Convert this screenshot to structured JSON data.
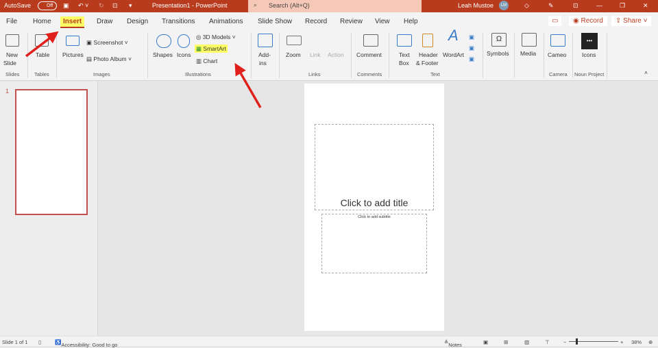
{
  "titlebar": {
    "autosave": "AutoSave",
    "toggle": "Off",
    "title": "Presentation1 - PowerPoint",
    "search_placeholder": "Search (Alt+Q)",
    "user": "Leah Mustoe",
    "user_initials": "LM"
  },
  "tabs": [
    "File",
    "Home",
    "Insert",
    "Draw",
    "Design",
    "Transitions",
    "Animations",
    "Slide Show",
    "Record",
    "Review",
    "View",
    "Help"
  ],
  "active_tab": "Insert",
  "right_buttons": {
    "record": "Record",
    "share": "Share"
  },
  "ribbon": {
    "slides": {
      "new_slide": "New",
      "new_slide2": "Slide",
      "group": "Slides"
    },
    "tables": {
      "table": "Table",
      "group": "Tables"
    },
    "images": {
      "pictures": "Pictures",
      "screenshot": "Screenshot",
      "photo_album": "Photo Album",
      "group": "Images"
    },
    "illustrations": {
      "shapes": "Shapes",
      "icons": "Icons",
      "models": "3D Models",
      "smartart": "SmartArt",
      "chart": "Chart",
      "group": "Illustrations"
    },
    "addins": {
      "l1": "Add-",
      "l2": "ins"
    },
    "links": {
      "zoom": "Zoom",
      "link": "Link",
      "action": "Action",
      "group": "Links"
    },
    "comments": {
      "comment": "Comment",
      "group": "Comments"
    },
    "text": {
      "textbox1": "Text",
      "textbox2": "Box",
      "header1": "Header",
      "header2": "& Footer",
      "wordart": "WordArt",
      "group": "Text"
    },
    "symbols": {
      "label": "Symbols"
    },
    "media": {
      "label": "Media"
    },
    "camera": {
      "cameo": "Cameo",
      "group": "Camera"
    },
    "noun": {
      "icons": "Icons",
      "group": "Noun Project"
    }
  },
  "slide_panel": {
    "number": "1"
  },
  "slide": {
    "title_placeholder": "Click to add title",
    "subtitle_placeholder": "Click to add subtitle"
  },
  "status": {
    "slide": "Slide 1 of 1",
    "accessibility": "Accessibility: Good to go",
    "notes": "Notes",
    "zoom": "38%"
  },
  "colors": {
    "titlebar": "#b83b1e",
    "highlight": "#ffff66",
    "arrow": "#e0201b"
  }
}
